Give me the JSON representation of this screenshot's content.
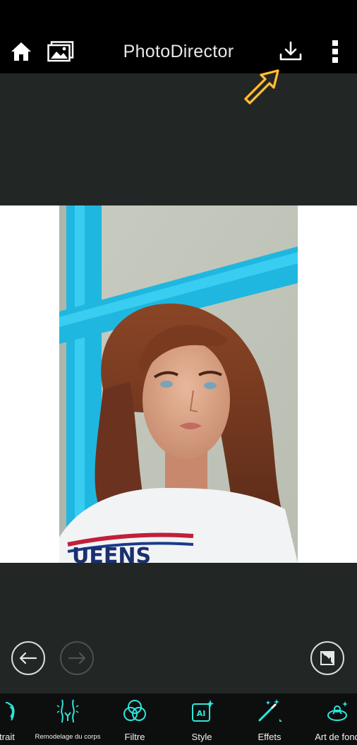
{
  "app": {
    "title": "PhotoDirector"
  },
  "top_bar": {
    "home": "home-icon",
    "gallery": "gallery-icon",
    "save": "download-icon",
    "menu": "more-vertical-icon"
  },
  "photo": {
    "text_on_shirt": "UEENS"
  },
  "history": {
    "undo": "undo-icon",
    "redo": "redo-icon",
    "compare": "compare-icon"
  },
  "tools": [
    {
      "label": "trait",
      "icon": "portrait-icon"
    },
    {
      "label": "Remodelage du corps",
      "icon": "body-reshape-icon"
    },
    {
      "label": "Filtre",
      "icon": "filter-icon"
    },
    {
      "label": "Style",
      "icon": "ai-style-icon"
    },
    {
      "label": "Effets",
      "icon": "magic-wand-icon"
    },
    {
      "label": "Art de fond",
      "icon": "background-art-icon"
    }
  ],
  "colors": {
    "accent": "#2ee6d9",
    "pointer": "#f4a30d",
    "background": "#222726"
  }
}
